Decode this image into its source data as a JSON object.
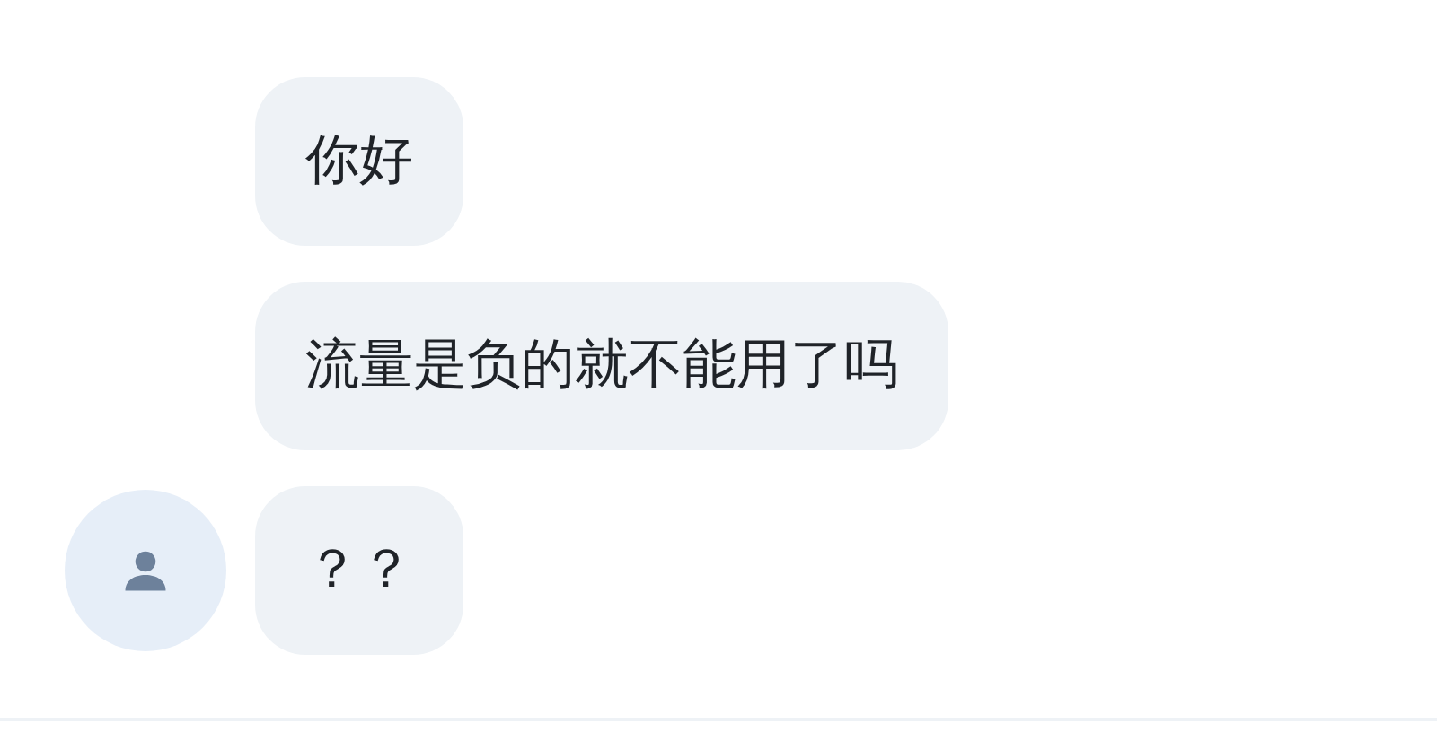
{
  "messages": [
    {
      "text": "你好",
      "avatar": false
    },
    {
      "text": "流量是负的就不能用了吗",
      "avatar": false
    },
    {
      "text": "？？",
      "avatar": true
    }
  ]
}
